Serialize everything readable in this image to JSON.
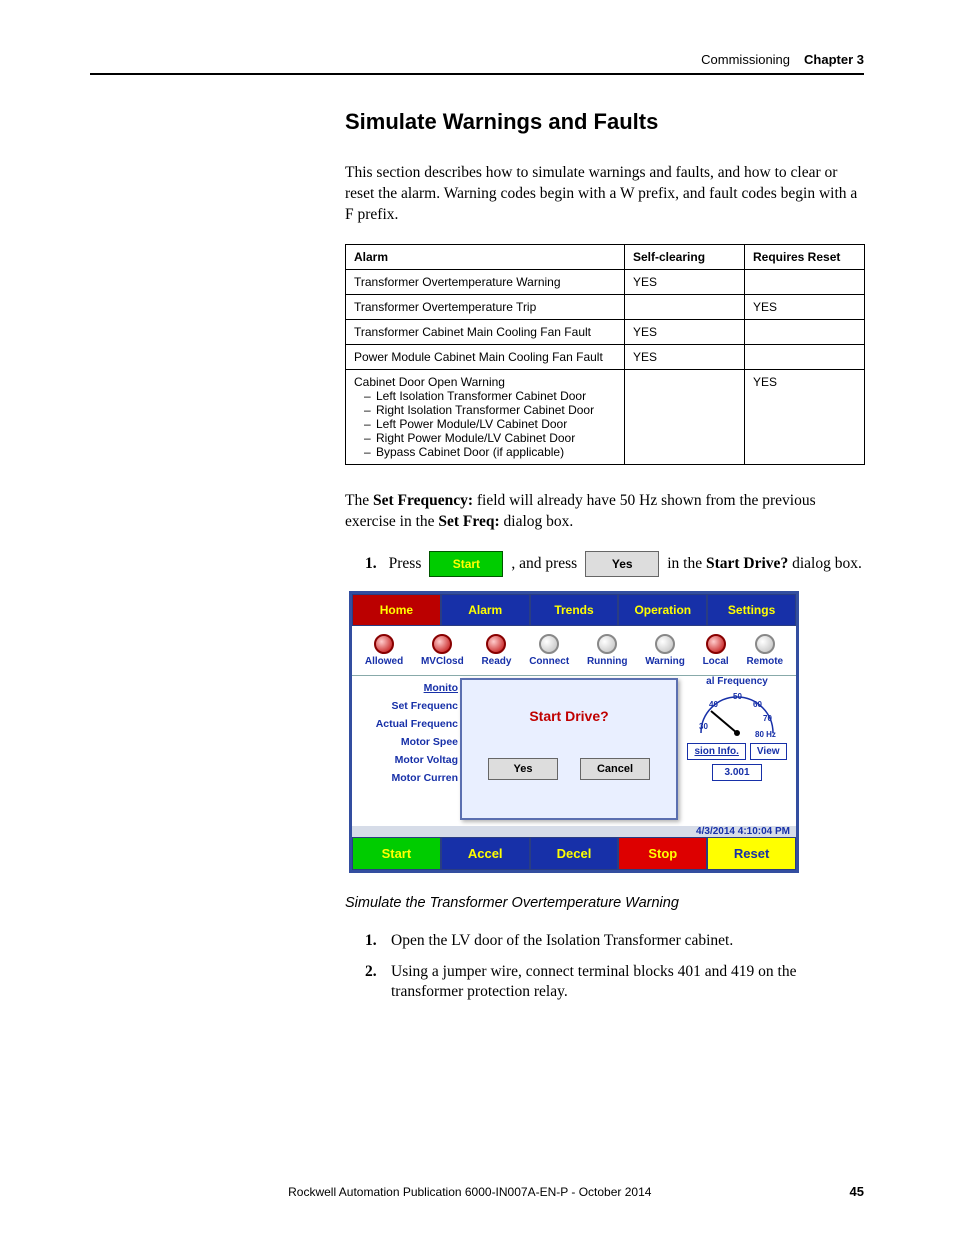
{
  "header": {
    "section": "Commissioning",
    "chapter": "Chapter 3"
  },
  "title": "Simulate Warnings and Faults",
  "intro": "This section describes how to simulate warnings and faults, and how to clear or reset the alarm. Warning codes begin with a W prefix, and fault codes begin with a F prefix.",
  "table": {
    "headers": [
      "Alarm",
      "Self-clearing",
      "Requires Reset"
    ],
    "rows": [
      {
        "alarm": "Transformer Overtemperature Warning",
        "self": "YES",
        "reset": ""
      },
      {
        "alarm": "Transformer Overtemperature Trip",
        "self": "",
        "reset": "YES"
      },
      {
        "alarm": "Transformer Cabinet Main Cooling Fan Fault",
        "self": "YES",
        "reset": ""
      },
      {
        "alarm": "Power Module Cabinet Main Cooling Fan Fault",
        "self": "YES",
        "reset": ""
      },
      {
        "alarm": "Cabinet Door Open Warning",
        "self": "",
        "reset": "YES",
        "sub": [
          "Left Isolation Transformer Cabinet Door",
          "Right Isolation Transformer Cabinet Door",
          "Left Power Module/LV Cabinet Door",
          "Right Power Module/LV Cabinet Door",
          "Bypass Cabinet Door (if applicable)"
        ]
      }
    ]
  },
  "freqpara": {
    "pre": "The ",
    "b1": "Set Frequency:",
    "mid": " field will already have 50 Hz shown from the previous exercise in the ",
    "b2": "Set Freq:",
    "post": " dialog box."
  },
  "step1": {
    "num": "1.",
    "press": "Press",
    "start": "Start",
    "andpress": ", and press",
    "yes": "Yes",
    "inthe": "in the ",
    "dlg": "Start Drive?",
    "post": " dialog box."
  },
  "shot": {
    "tabs": [
      "Home",
      "Alarm",
      "Trends",
      "Operation",
      "Settings"
    ],
    "status": [
      "Allowed",
      "MVClosd",
      "Ready",
      "Connect",
      "Running",
      "Warning",
      "Local",
      "Remote"
    ],
    "left": [
      "Monito",
      "Set Frequenc",
      "Actual Frequenc",
      "Motor Spee",
      "Motor Voltag",
      "Motor Curren"
    ],
    "dialog": {
      "title": "Start Drive?",
      "yes": "Yes",
      "cancel": "Cancel"
    },
    "right": {
      "label": "al Frequency",
      "ticks": [
        "30",
        "40",
        "50",
        "60",
        "70",
        "80 Hz"
      ],
      "sion": "sion Info.",
      "view": "View",
      "val": "3.001"
    },
    "timestamp": "4/3/2014 4:10:04 PM",
    "bottom": [
      "Start",
      "Accel",
      "Decel",
      "Stop",
      "Reset"
    ]
  },
  "subhead": "Simulate the Transformer Overtemperature Warning",
  "steps2": [
    {
      "n": "1.",
      "t": "Open the LV door of the Isolation Transformer cabinet."
    },
    {
      "n": "2.",
      "t": "Using a jumper wire, connect terminal blocks 401 and 419 on the transformer protection relay."
    }
  ],
  "footer": {
    "pub": "Rockwell Automation Publication 6000-IN007A-EN-P - October 2014",
    "page": "45"
  }
}
